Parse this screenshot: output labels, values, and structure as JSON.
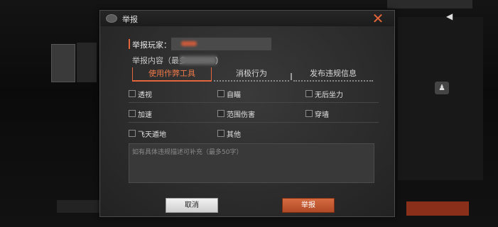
{
  "dialog": {
    "title": "举报",
    "close_symbol": "✕",
    "player_label": "举报玩家：",
    "content_label_prefix": "举报内容（最多",
    "content_label_suffix": "）",
    "tabs": [
      {
        "label": "使用作弊工具",
        "active": true
      },
      {
        "label": "消极行为",
        "active": false
      },
      {
        "label": "发布违规信息",
        "active": false
      }
    ],
    "options": [
      {
        "label": "透视",
        "checked": false
      },
      {
        "label": "自瞄",
        "checked": false
      },
      {
        "label": "无后坐力",
        "checked": false
      },
      {
        "label": "加速",
        "checked": false
      },
      {
        "label": "范围伤害",
        "checked": false
      },
      {
        "label": "穿墙",
        "checked": false
      },
      {
        "label": "飞天遁地",
        "checked": false
      },
      {
        "label": "其他",
        "checked": false
      }
    ],
    "description_placeholder": "如有具体违规描述可补充（最多50字）",
    "cancel_label": "取消",
    "report_label": "举报"
  },
  "background": {
    "right_icon_glyph": "♟",
    "top_right_icon_glyph": "◀"
  },
  "colors": {
    "accent": "#e2653b",
    "dialog_bg": "#2d2d2d"
  }
}
